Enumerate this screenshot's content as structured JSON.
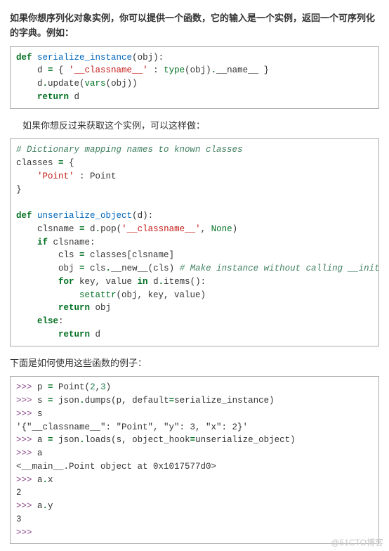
{
  "para1": "如果你想序列化对象实例，你可以提供一个函数，它的输入是一个实例，返回一个可序列化的字典。例如：",
  "code1": {
    "l1a": "def",
    "l1b": "serialize_instance",
    "l1c": "(obj):",
    "l2a": "    d ",
    "l2b": "=",
    "l2c": " { ",
    "l2d": "'__classname__'",
    "l2e": " : ",
    "l2f": "type",
    "l2g": "(obj)",
    "l2h": ".",
    "l2i": "__name__",
    "l2j": " }",
    "l3a": "    d",
    "l3b": ".",
    "l3c": "update(",
    "l3d": "vars",
    "l3e": "(obj))",
    "l4a": "    ",
    "l4b": "return",
    "l4c": " d"
  },
  "para2": "如果你想反过来获取这个实例，可以这样做：",
  "code2": {
    "l1": "# Dictionary mapping names to known classes",
    "l2a": "classes ",
    "l2b": "=",
    "l2c": " {",
    "l3a": "    ",
    "l3b": "'Point'",
    "l3c": " : Point",
    "l4": "}",
    "blank": "",
    "l5a": "def",
    "l5b": "unserialize_object",
    "l5c": "(d):",
    "l6a": "    clsname ",
    "l6b": "=",
    "l6c": " d",
    "l6d": ".",
    "l6e": "pop(",
    "l6f": "'__classname__'",
    "l6g": ", ",
    "l6h": "None",
    "l6i": ")",
    "l7a": "    ",
    "l7b": "if",
    "l7c": " clsname:",
    "l8a": "        cls ",
    "l8b": "=",
    "l8c": " classes[clsname]",
    "l9a": "        obj ",
    "l9b": "=",
    "l9c": " cls",
    "l9d": ".",
    "l9e": "__new__",
    "l9f": "(cls) ",
    "l9g": "# Make instance without calling __init__",
    "l10a": "        ",
    "l10b": "for",
    "l10c": " key, value ",
    "l10d": "in",
    "l10e": " d",
    "l10f": ".",
    "l10g": "items():",
    "l11a": "            ",
    "l11b": "setattr",
    "l11c": "(obj, key, value)",
    "l12a": "        ",
    "l12b": "return",
    "l12c": " obj",
    "l13a": "    ",
    "l13b": "else",
    "l13c": ":",
    "l14a": "        ",
    "l14b": "return",
    "l14c": " d"
  },
  "para3": "下面是如何使用这些函数的例子：",
  "code3": {
    "p": ">>> ",
    "l1a": "p ",
    "l1b": "=",
    "l1c": " Point(",
    "l1d": "2",
    "l1e": ",",
    "l1f": "3",
    "l1g": ")",
    "l2a": "s ",
    "l2b": "=",
    "l2c": " json",
    "l2d": ".",
    "l2e": "dumps(p, default",
    "l2f": "=",
    "l2g": "serialize_instance)",
    "l3": "s",
    "l4": "'{\"__classname__\": \"Point\", \"y\": 3, \"x\": 2}'",
    "l5a": "a ",
    "l5b": "=",
    "l5c": " json",
    "l5d": ".",
    "l5e": "loads(s, object_hook",
    "l5f": "=",
    "l5g": "unserialize_object)",
    "l6": "a",
    "l7": "<__main__.Point object at 0x1017577d0>",
    "l8a": "a",
    "l8b": ".",
    "l8c": "x",
    "l9": "2",
    "l10a": "a",
    "l10b": ".",
    "l10c": "y",
    "l11": "3",
    "l12": ">>>"
  },
  "watermark": "@51CTO博客"
}
